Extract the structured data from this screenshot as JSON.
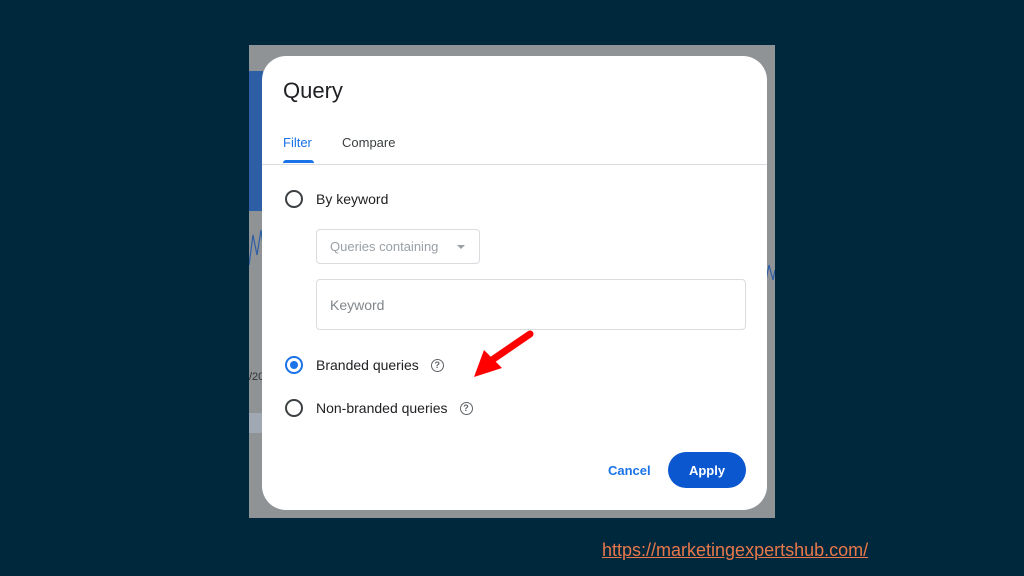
{
  "dialog": {
    "title": "Query",
    "tabs": [
      {
        "label": "Filter",
        "active": true
      },
      {
        "label": "Compare",
        "active": false
      }
    ],
    "options": {
      "by_keyword": {
        "label": "By keyword",
        "selected": false
      },
      "branded": {
        "label": "Branded queries",
        "selected": true
      },
      "non_branded": {
        "label": "Non-branded queries",
        "selected": false
      }
    },
    "select": {
      "value": "Queries containing"
    },
    "keyword_input": {
      "placeholder": "Keyword",
      "value": ""
    },
    "help_icon_glyph": "?",
    "actions": {
      "cancel_label": "Cancel",
      "apply_label": "Apply"
    }
  },
  "background": {
    "partial_date_text": "/20"
  },
  "footer": {
    "link": "https://marketingexpertshub.com/"
  },
  "colors": {
    "slide_background": "#00283d",
    "accent_blue": "#1a73e8",
    "apply_button": "#0b57d0",
    "arrow_red": "#ff0000",
    "link_orange": "#e8784a"
  },
  "icons": [
    "help-icon",
    "dropdown-arrow-icon",
    "red-arrow-icon"
  ]
}
